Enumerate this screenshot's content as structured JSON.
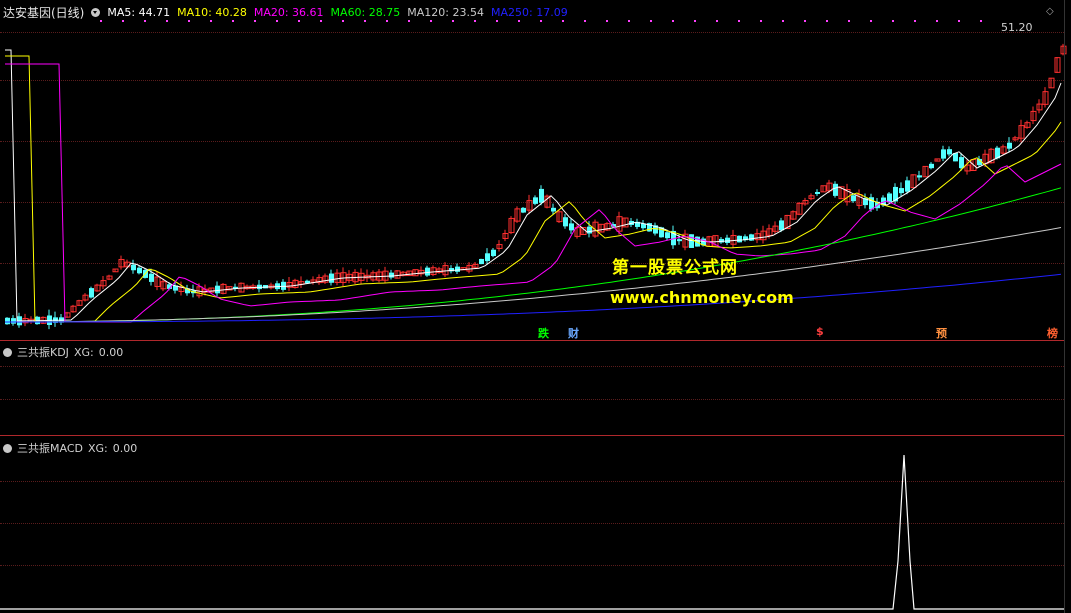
{
  "main": {
    "stock_title": "达安基因(日线)",
    "ma": [
      {
        "label": "MA5:",
        "value": "44.71",
        "color": "#ffffff"
      },
      {
        "label": "MA10:",
        "value": "40.28",
        "color": "#ffff00"
      },
      {
        "label": "MA20:",
        "value": "36.61",
        "color": "#ff00ff"
      },
      {
        "label": "MA60:",
        "value": "28.75",
        "color": "#00ff00"
      },
      {
        "label": "MA120:",
        "value": "23.54",
        "color": "#c8c8c8"
      },
      {
        "label": "MA250:",
        "value": "17.09",
        "color": "#2020ff"
      }
    ],
    "high_price": "51.20",
    "watermark_cn": "第一股票公式网",
    "watermark_url": "www.chnmoney.com",
    "signals": [
      {
        "text": "跌",
        "color": "#00ff00"
      },
      {
        "text": "财",
        "color": "#6aa8ff"
      },
      {
        "text": "$",
        "color": "#ff4040"
      },
      {
        "text": "预",
        "color": "#ff9040"
      },
      {
        "text": "榜",
        "color": "#ff6030"
      }
    ],
    "colors": {
      "up": "#ff3030",
      "down": "#54ffff",
      "background": "#000000",
      "separator": "#b0282c"
    }
  },
  "kdj": {
    "label": "三共振KDJ",
    "xg_label": "XG:",
    "xg_value": "0.00"
  },
  "macd": {
    "label": "三共振MACD",
    "xg_label": "XG:",
    "xg_value": "0.00"
  },
  "icons": {
    "toggle": "dropdown-toggle-icon",
    "scroll": "scroll-up-icon"
  }
}
